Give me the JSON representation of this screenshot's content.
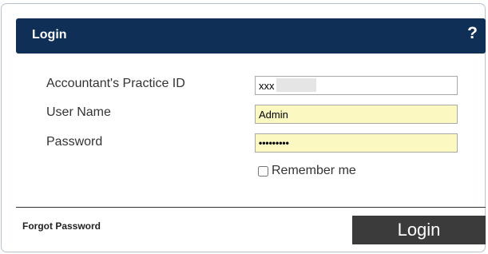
{
  "header": {
    "title": "Login",
    "help_symbol": "?"
  },
  "form": {
    "practice_id": {
      "label": "Accountant's Practice ID",
      "value": "xxx"
    },
    "user_name": {
      "label": "User Name",
      "value": "Admin"
    },
    "password": {
      "label": "Password",
      "value": "•••••••••"
    },
    "remember_me": {
      "label": "Remember me",
      "checked": false
    }
  },
  "footer": {
    "forgot_password_label": "Forgot Password",
    "login_button_label": "Login"
  },
  "colors": {
    "header_background": "#0f2f57",
    "autofill_background": "#fbf8c2",
    "login_button_background": "#3b3b3b"
  },
  "icons": {
    "help": "question-mark-icon"
  }
}
